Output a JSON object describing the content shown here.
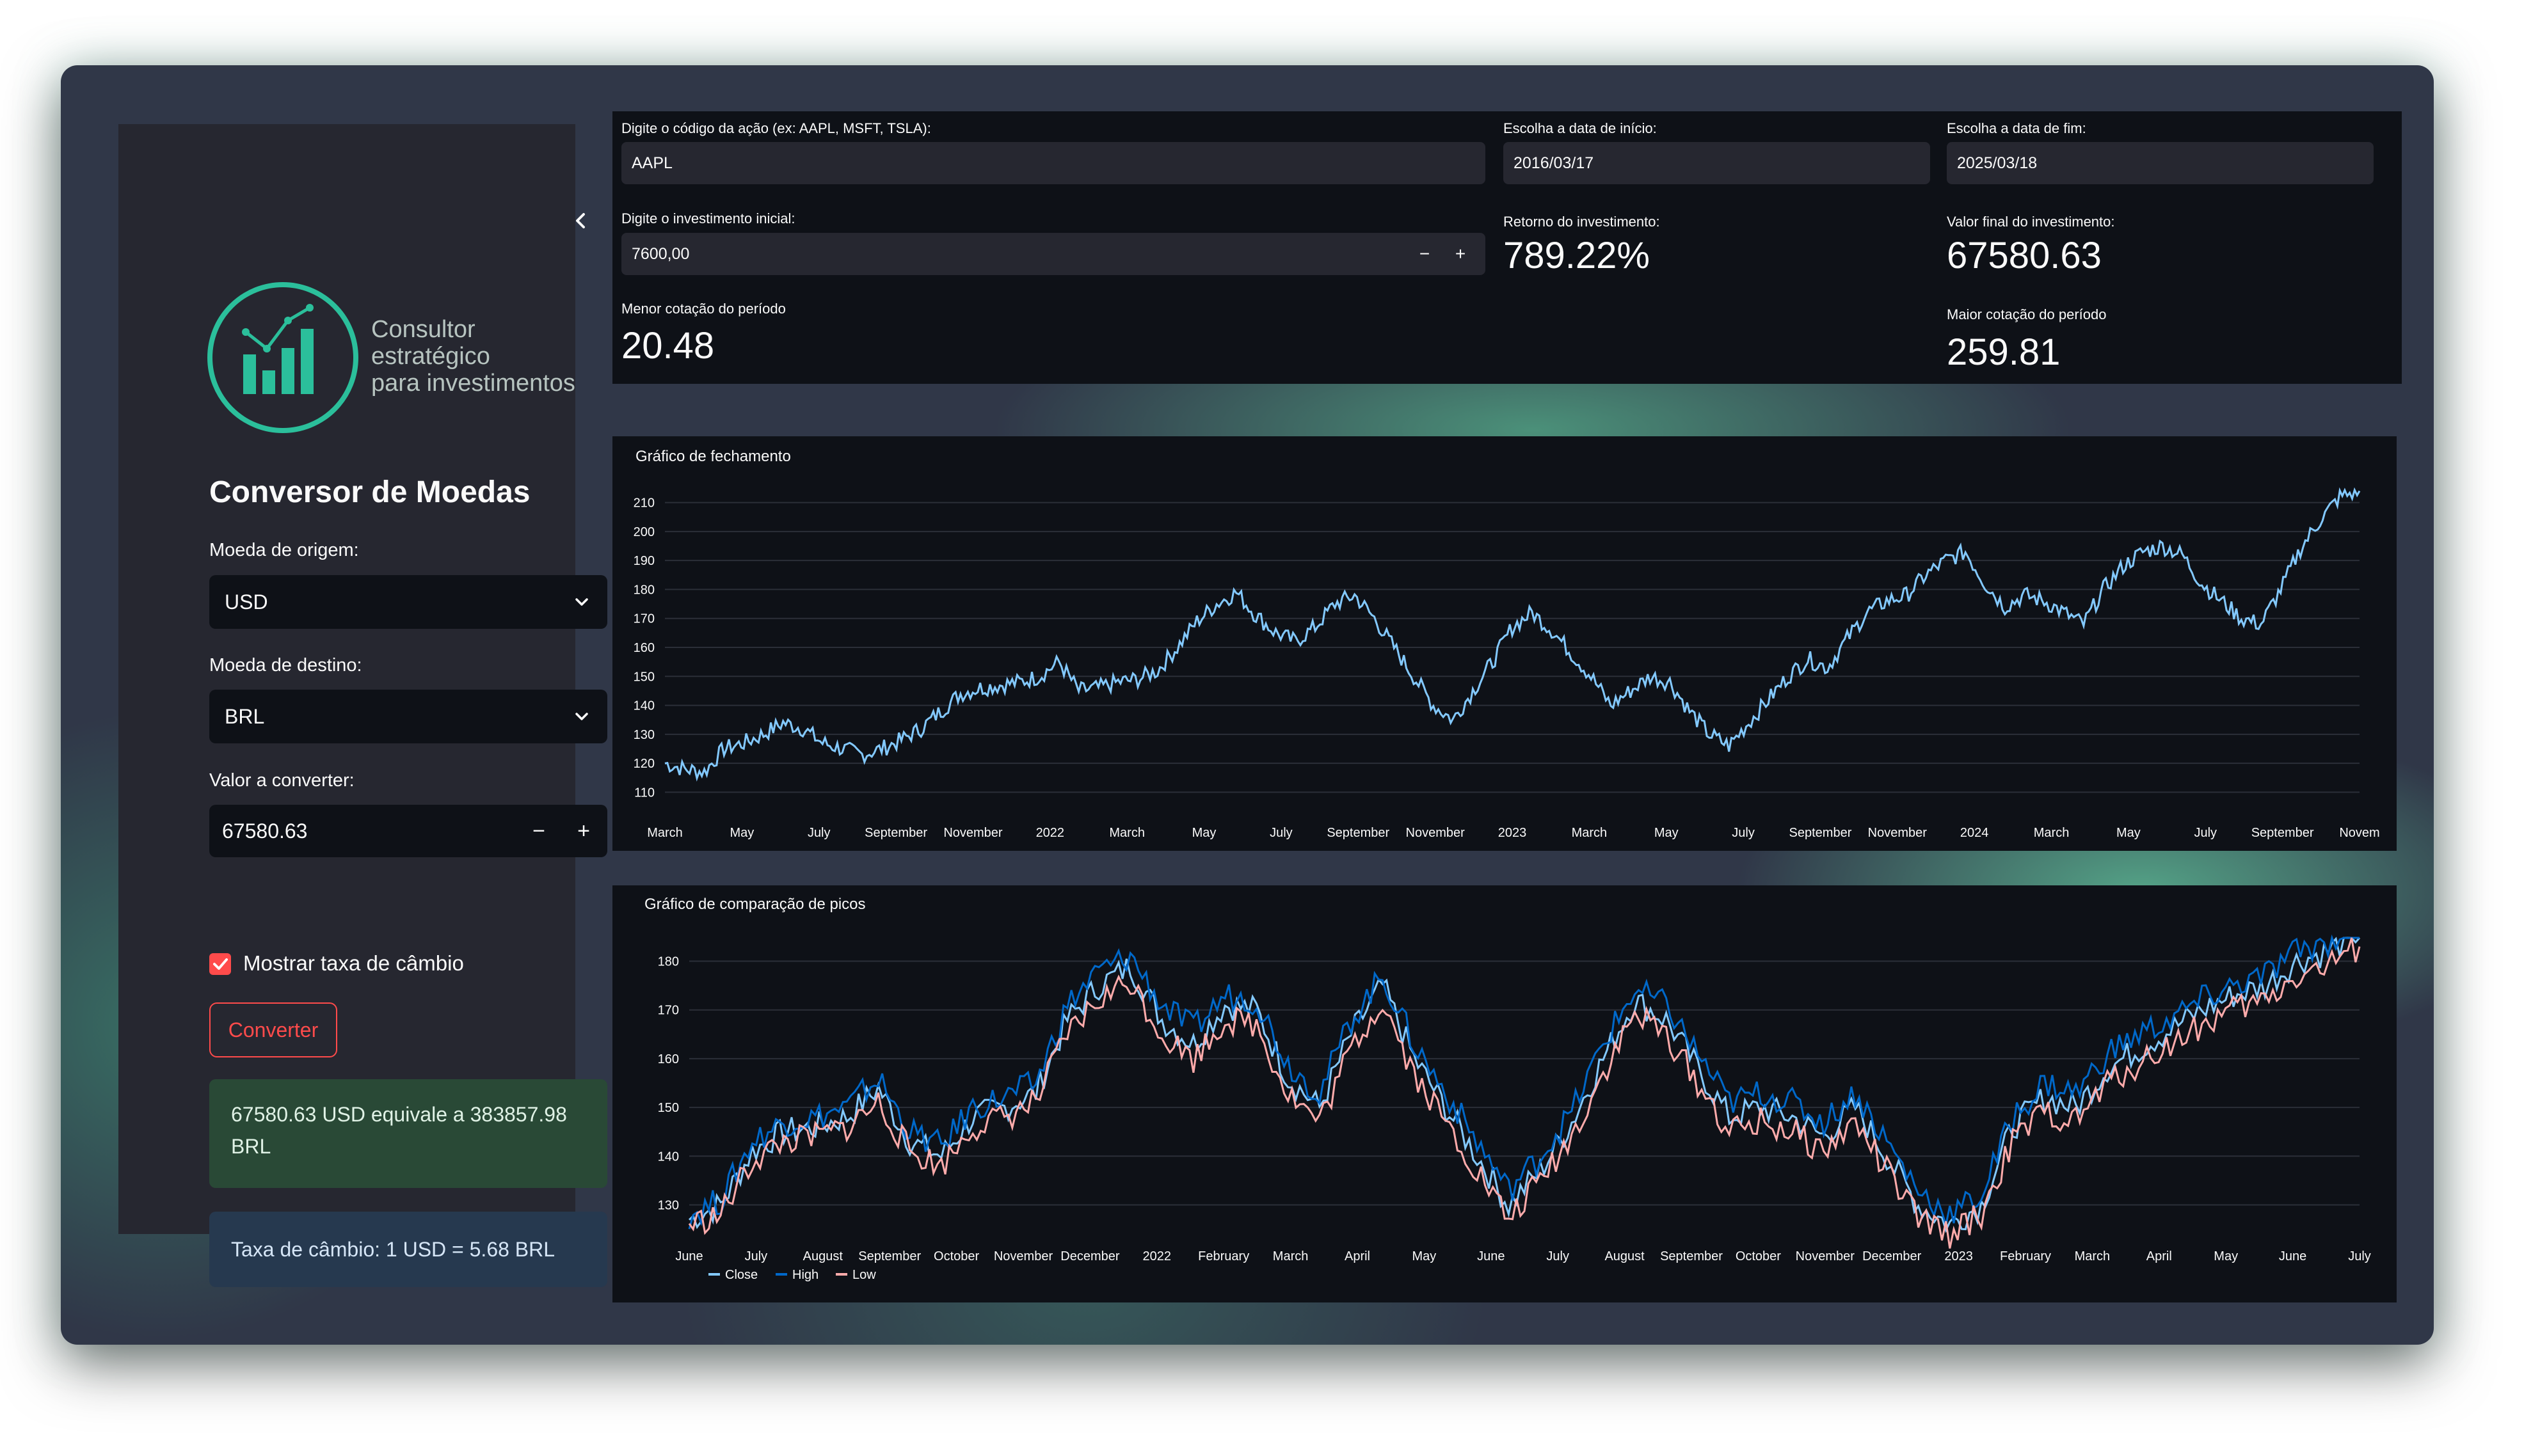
{
  "sidebar": {
    "logo_text_line1": "Consultor estratégico",
    "logo_text_line2": "para investimentos",
    "title": "Conversor de Moedas",
    "origin_label": "Moeda de origem:",
    "origin_value": "USD",
    "dest_label": "Moeda de destino:",
    "dest_value": "BRL",
    "amount_label": "Valor a converter:",
    "amount_value": "67580.63",
    "minus": "−",
    "plus": "+",
    "checkbox_label": "Mostrar taxa de câmbio",
    "convert_button": "Converter",
    "result_text": "67580.63 USD equivale a 383857.98 BRL",
    "rate_text": "Taxa de câmbio: 1 USD = 5.68 BRL"
  },
  "top": {
    "ticker_label": "Digite o código da ação (ex: AAPL, MSFT, TSLA):",
    "ticker_value": "AAPL",
    "start_label": "Escolha a data de início:",
    "start_value": "2016/03/17",
    "end_label": "Escolha a data de fim:",
    "end_value": "2025/03/18",
    "invest_label": "Digite o investimento inicial:",
    "invest_value": "7600,00",
    "minus": "−",
    "plus": "+",
    "return_label": "Retorno do investimento:",
    "return_value": "789.22%",
    "final_label": "Valor final do investimento:",
    "final_value": "67580.63",
    "min_label": "Menor cotação do período",
    "min_value": "20.48",
    "max_label": "Maior cotação do período",
    "max_value": "259.81"
  },
  "colors": {
    "accent": "#ff4b4b",
    "close_line_chart1": "#83c9ff",
    "close": "#83c9ff",
    "high": "#0068c9",
    "low": "#ffabab",
    "logo": "#2bbf9b"
  },
  "chart_data": [
    {
      "type": "line",
      "title": "Gráfico de fechamento",
      "x_ticks": [
        "March",
        "May",
        "July",
        "September",
        "November",
        "2022",
        "March",
        "May",
        "July",
        "September",
        "November",
        "2023",
        "March",
        "May",
        "July",
        "September",
        "November",
        "2024",
        "March",
        "May",
        "July",
        "September",
        "Novem"
      ],
      "y_ticks": [
        110,
        120,
        130,
        140,
        150,
        160,
        170,
        180,
        190,
        200,
        210
      ],
      "ylim": [
        107,
        213
      ],
      "series": [
        {
          "values": [
            120,
            118,
            117,
            125,
            127,
            130,
            134,
            132,
            127,
            125,
            123,
            125,
            128,
            132,
            138,
            144,
            146,
            147,
            148,
            150,
            155,
            145,
            146,
            148,
            149,
            152,
            160,
            169,
            175,
            179,
            171,
            165,
            162,
            167,
            175,
            178,
            170,
            160,
            150,
            140,
            135,
            145,
            155,
            167,
            172,
            166,
            158,
            150,
            140,
            145,
            150,
            148,
            138,
            130,
            126,
            134,
            142,
            150,
            156,
            153,
            163,
            172,
            176,
            178,
            185,
            190,
            193,
            182,
            174,
            178,
            176,
            172,
            168,
            180,
            188,
            193,
            195,
            192,
            182,
            176,
            170,
            168,
            180,
            194,
            204,
            212,
            214
          ]
        }
      ]
    },
    {
      "type": "line",
      "title": "Gráfico de comparação de picos",
      "x_ticks": [
        "June",
        "July",
        "August",
        "September",
        "October",
        "November",
        "December",
        "2022",
        "February",
        "March",
        "April",
        "May",
        "June",
        "July",
        "August",
        "September",
        "October",
        "November",
        "December",
        "2023",
        "February",
        "March",
        "April",
        "May",
        "June",
        "July"
      ],
      "y_ticks": [
        130,
        140,
        150,
        160,
        170,
        180
      ],
      "ylim": [
        126,
        184
      ],
      "legend": [
        "Close",
        "High",
        "Low"
      ],
      "series": [
        {
          "name": "Close",
          "values": [
            127,
            130,
            141,
            145,
            146,
            148,
            154,
            143,
            140,
            148,
            150,
            153,
            168,
            175,
            179,
            168,
            163,
            171,
            170,
            156,
            150,
            165,
            175,
            160,
            150,
            140,
            130,
            137,
            147,
            160,
            172,
            168,
            158,
            148,
            150,
            148,
            144,
            150,
            140,
            130,
            126,
            130,
            146,
            152,
            150,
            158,
            162,
            166,
            170,
            173,
            175,
            180,
            182,
            186
          ]
        },
        {
          "name": "High",
          "values": [
            128,
            131,
            143,
            147,
            148,
            150,
            156,
            145,
            142,
            150,
            152,
            155,
            171,
            178,
            181,
            171,
            166,
            173,
            172,
            159,
            153,
            168,
            177,
            163,
            153,
            143,
            133,
            140,
            149,
            163,
            174,
            171,
            161,
            151,
            153,
            151,
            147,
            153,
            143,
            133,
            128,
            132,
            148,
            155,
            153,
            161,
            165,
            168,
            172,
            175,
            177,
            182,
            184,
            188
          ]
        },
        {
          "name": "Low",
          "values": [
            126,
            128,
            139,
            143,
            144,
            146,
            151,
            141,
            138,
            146,
            148,
            151,
            165,
            172,
            176,
            165,
            160,
            168,
            167,
            153,
            147,
            162,
            172,
            157,
            147,
            137,
            127,
            135,
            144,
            157,
            169,
            165,
            155,
            145,
            147,
            145,
            141,
            147,
            137,
            127,
            124,
            128,
            143,
            149,
            147,
            155,
            159,
            163,
            167,
            170,
            172,
            177,
            179,
            183
          ]
        }
      ]
    }
  ]
}
